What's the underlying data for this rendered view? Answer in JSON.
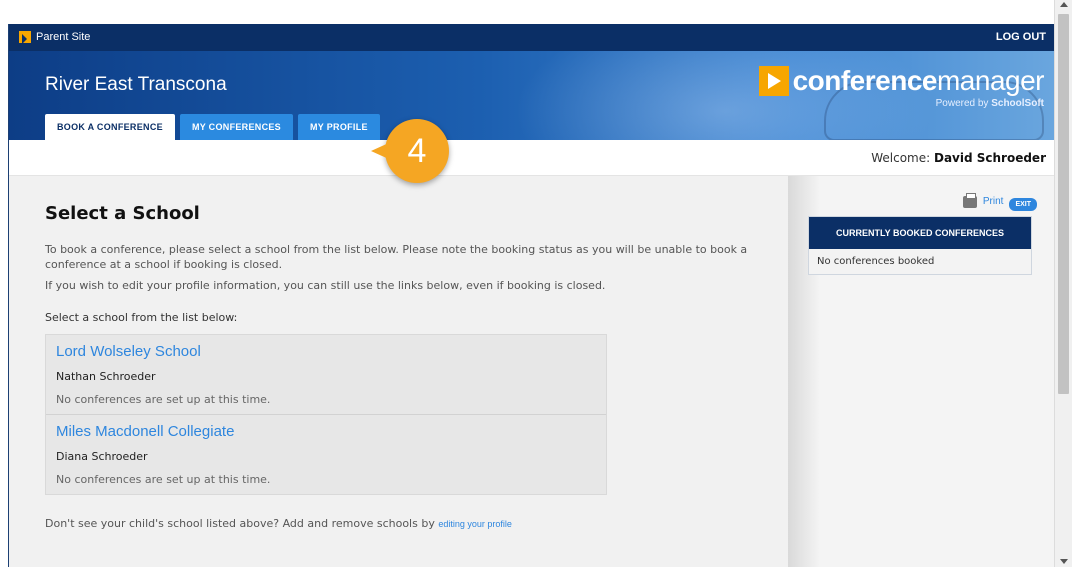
{
  "topbar": {
    "parent_site": "Parent Site",
    "logout": "LOG OUT"
  },
  "banner": {
    "district": "River East Transcona",
    "logo_word_bold": "conference",
    "logo_word_light": "manager",
    "powered_prefix": "Powered by ",
    "powered_brand": "SchoolSoft"
  },
  "tabs": [
    {
      "label": "BOOK A CONFERENCE",
      "active": true
    },
    {
      "label": "MY CONFERENCES",
      "active": false
    },
    {
      "label": "MY PROFILE",
      "active": false
    }
  ],
  "callout": {
    "number": "4",
    "color": "#f5a623"
  },
  "welcome": {
    "prefix": "Welcome: ",
    "name": "David Schroeder"
  },
  "main": {
    "title": "Select a School",
    "para1": "To book a conference, please select a school from the list below. Please note the booking status as you will be unable to book a conference at a school if booking is closed.",
    "para2": "If you wish to edit your profile information, you can still use the links below, even if booking is closed.",
    "select_label": "Select a school from the list below:",
    "schools": [
      {
        "name": "Lord Wolseley School",
        "student": "Nathan Schroeder",
        "status": "No conferences are set up at this time."
      },
      {
        "name": "Miles Macdonell Collegiate",
        "student": "Diana Schroeder",
        "status": "No conferences are set up at this time."
      }
    ],
    "footer_text": "Don't see your child's school listed above? Add and remove schools by ",
    "footer_link": "editing your profile"
  },
  "sidebar": {
    "print_label": "Print",
    "exit_label": "EXIT",
    "booked_header": "CURRENTLY BOOKED CONFERENCES",
    "booked_empty": "No conferences booked"
  },
  "colors": {
    "navy": "#0b2f66",
    "tab_blue": "#2b8ae0",
    "link_blue": "#2e86de",
    "accent_orange": "#f7a600"
  },
  "icons": [
    "logo-arrow-icon",
    "print-icon"
  ]
}
